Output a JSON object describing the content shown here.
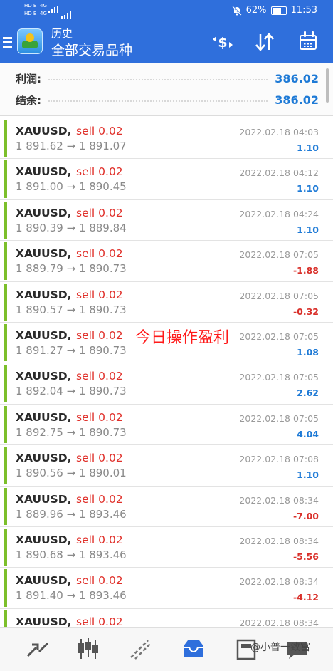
{
  "status_bar": {
    "battery": "62%",
    "time": "11:53",
    "signal_labels": [
      "HD B",
      "4G",
      "HD B",
      "4G"
    ]
  },
  "header": {
    "subtitle": "历史",
    "title": "全部交易品种",
    "icons": [
      "menu-icon",
      "dollar-swap-icon",
      "sort-icon",
      "calendar-icon"
    ]
  },
  "summary": {
    "profit_label": "利润:",
    "profit_value": "386.02",
    "balance_label": "结余:",
    "balance_value": "386.02"
  },
  "trades": [
    {
      "symbol": "XAUUSD,",
      "type": "sell 0.02",
      "prices": "1 891.62 → 1 891.07",
      "time": "2022.02.18 04:03",
      "profit": "1.10"
    },
    {
      "symbol": "XAUUSD,",
      "type": "sell 0.02",
      "prices": "1 891.00 → 1 890.45",
      "time": "2022.02.18 04:12",
      "profit": "1.10"
    },
    {
      "symbol": "XAUUSD,",
      "type": "sell 0.02",
      "prices": "1 890.39 → 1 889.84",
      "time": "2022.02.18 04:24",
      "profit": "1.10"
    },
    {
      "symbol": "XAUUSD,",
      "type": "sell 0.02",
      "prices": "1 889.79 → 1 890.73",
      "time": "2022.02.18 07:05",
      "profit": "-1.88"
    },
    {
      "symbol": "XAUUSD,",
      "type": "sell 0.02",
      "prices": "1 890.57 → 1 890.73",
      "time": "2022.02.18 07:05",
      "profit": "-0.32"
    },
    {
      "symbol": "XAUUSD,",
      "type": "sell 0.02",
      "prices": "1 891.27 → 1 890.73",
      "time": "2022.02.18 07:05",
      "profit": "1.08"
    },
    {
      "symbol": "XAUUSD,",
      "type": "sell 0.02",
      "prices": "1 892.04 → 1 890.73",
      "time": "2022.02.18 07:05",
      "profit": "2.62"
    },
    {
      "symbol": "XAUUSD,",
      "type": "sell 0.02",
      "prices": "1 892.75 → 1 890.73",
      "time": "2022.02.18 07:05",
      "profit": "4.04"
    },
    {
      "symbol": "XAUUSD,",
      "type": "sell 0.02",
      "prices": "1 890.56 → 1 890.01",
      "time": "2022.02.18 07:08",
      "profit": "1.10"
    },
    {
      "symbol": "XAUUSD,",
      "type": "sell 0.02",
      "prices": "1 889.96 → 1 893.46",
      "time": "2022.02.18 08:34",
      "profit": "-7.00"
    },
    {
      "symbol": "XAUUSD,",
      "type": "sell 0.02",
      "prices": "1 890.68 → 1 893.46",
      "time": "2022.02.18 08:34",
      "profit": "-5.56"
    },
    {
      "symbol": "XAUUSD,",
      "type": "sell 0.02",
      "prices": "1 891.40 → 1 893.46",
      "time": "2022.02.18 08:34",
      "profit": "-4.12"
    },
    {
      "symbol": "XAUUSD,",
      "type": "sell 0.02",
      "prices": "",
      "time": "2022.02.18 08:34",
      "profit": ""
    }
  ],
  "overlay_text": "今日操作盈利",
  "bottom_nav": {
    "items": [
      "quotes-icon",
      "chart-icon",
      "trade-icon",
      "history-icon",
      "news-icon",
      "messages-icon"
    ],
    "active": "history-icon"
  },
  "watermark": "@小普一致富",
  "colors": {
    "accent": "#2f6fdc",
    "positive": "#1e7ad6",
    "negative": "#d9302a",
    "sell": "#e0302a",
    "row_marker": "#7cbf2a"
  }
}
